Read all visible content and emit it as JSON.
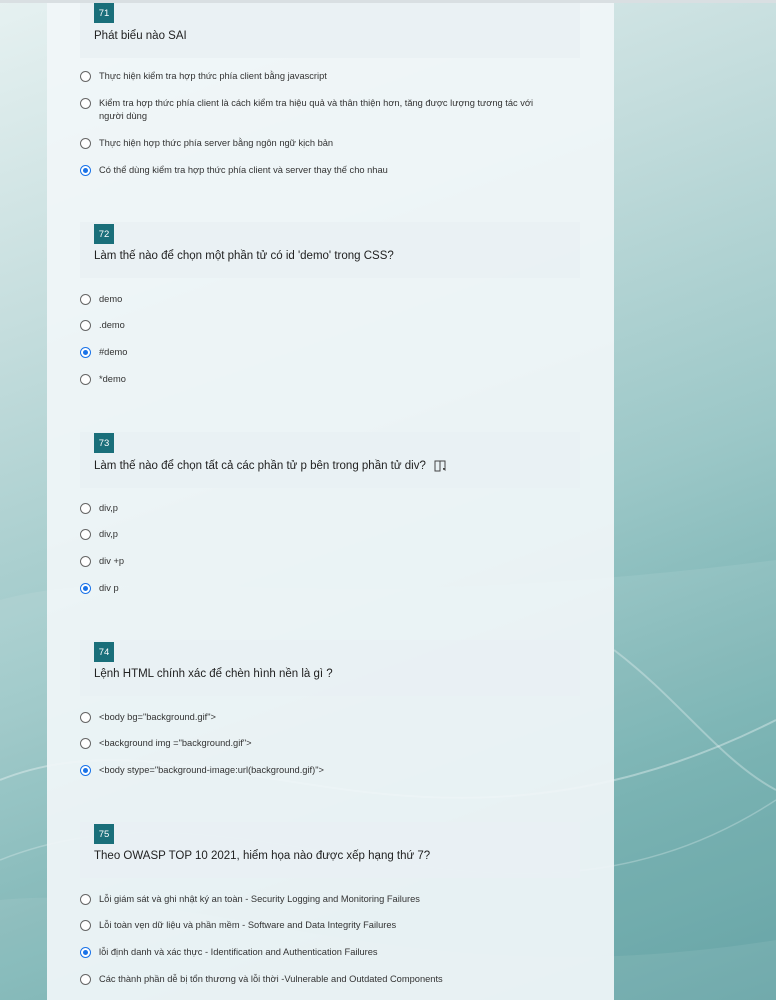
{
  "questions": [
    {
      "number": "71",
      "text": "Phát biểu nào SAI",
      "options": [
        {
          "label": "Thực hiện kiểm tra hợp thức phía client bằng javascript",
          "checked": false
        },
        {
          "label": "Kiểm tra hợp thức phía client là cách kiểm tra hiệu quả và thân thiện hơn, tăng được lượng tương tác với người dùng",
          "checked": false
        },
        {
          "label": "Thực hiện hợp thức phía server bằng ngôn ngữ kịch bản",
          "checked": false
        },
        {
          "label": "Có thể dùng kiểm tra hợp thức phía client và server thay thế cho nhau",
          "checked": true
        }
      ]
    },
    {
      "number": "72",
      "text": "Làm thế nào để chọn một phần tử có id 'demo' trong CSS?",
      "options": [
        {
          "label": "demo",
          "checked": false
        },
        {
          "label": ".demo",
          "checked": false
        },
        {
          "label": "#demo",
          "checked": true
        },
        {
          "label": "*demo",
          "checked": false
        }
      ]
    },
    {
      "number": "73",
      "text": "Làm thế nào để chọn tất cả các phần tử p bên trong phần tử div?",
      "icon": "immersive-reader-icon",
      "options": [
        {
          "label": "div,p",
          "checked": false
        },
        {
          "label": "div,p",
          "checked": false
        },
        {
          "label": "div +p",
          "checked": false
        },
        {
          "label": "div p",
          "checked": true
        }
      ]
    },
    {
      "number": "74",
      "text": "Lệnh HTML chính xác để chèn hình nền là gì ?",
      "options": [
        {
          "label": "<body bg=\"background.gif\">",
          "checked": false
        },
        {
          "label": "<background img =\"background.gif\">",
          "checked": false
        },
        {
          "label": "<body stype=\"background-image:url(background.gif)\">",
          "checked": true
        }
      ]
    },
    {
      "number": "75",
      "text": "Theo OWASP TOP 10 2021, hiểm họa nào được xếp hạng thứ 7?",
      "options": [
        {
          "label": "Lỗi giám sát và ghi nhật ký an toàn - Security Logging and Monitoring Failures",
          "checked": false
        },
        {
          "label": "Lỗi toàn vẹn dữ liệu và phần mềm - Software and Data Integrity Failures",
          "checked": false
        },
        {
          "label": "lỗi định danh và xác thực - Identification and Authentication Failures",
          "checked": true
        },
        {
          "label": " Các thành phần dễ bị tổn thương và lỗi thời -Vulnerable and Outdated Components",
          "checked": false
        }
      ]
    }
  ]
}
